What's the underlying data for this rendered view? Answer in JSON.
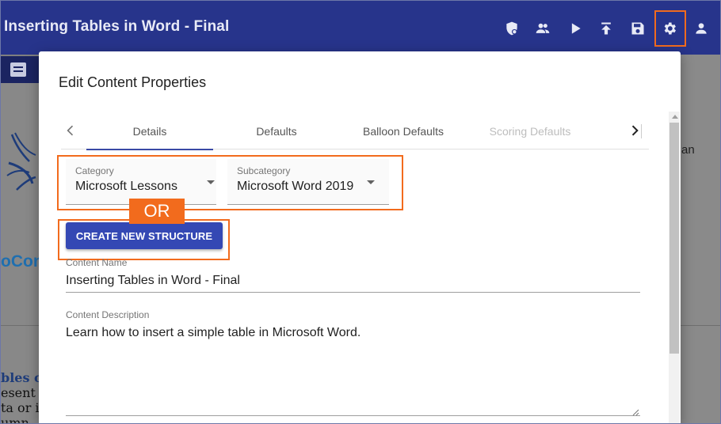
{
  "app": {
    "title": "Inserting Tables in Word - Final"
  },
  "toolbar": {
    "icons": [
      "shield-lock-icon",
      "users-icon",
      "play-icon",
      "upload-icon",
      "save-icon",
      "gear-icon",
      "account-icon"
    ],
    "highlighted": "gear-icon"
  },
  "background": {
    "company_fragment": "oCon",
    "right_fragment": "an",
    "text_lines": [
      "bles c",
      "esent c",
      "ta or i",
      "umn"
    ]
  },
  "modal": {
    "title": "Edit Content Properties",
    "tabs": [
      {
        "label": "Details",
        "state": "active"
      },
      {
        "label": "Defaults",
        "state": "normal"
      },
      {
        "label": "Balloon Defaults",
        "state": "normal"
      },
      {
        "label": "Scoring Defaults",
        "state": "disabled"
      }
    ],
    "category": {
      "label": "Category",
      "value": "Microsoft Lessons"
    },
    "subcategory": {
      "label": "Subcategory",
      "value": "Microsoft Word 2019"
    },
    "or_badge": "OR",
    "create_button": "CREATE NEW STRUCTURE",
    "content_name": {
      "label": "Content Name",
      "value": "Inserting Tables in Word - Final"
    },
    "content_description": {
      "label": "Content Description",
      "value": "Learn how to insert a simple table in Microsoft Word."
    }
  },
  "colors": {
    "app_bar": "#27348b",
    "accent_orange": "#f26b1d",
    "button_blue": "#3448b4"
  }
}
